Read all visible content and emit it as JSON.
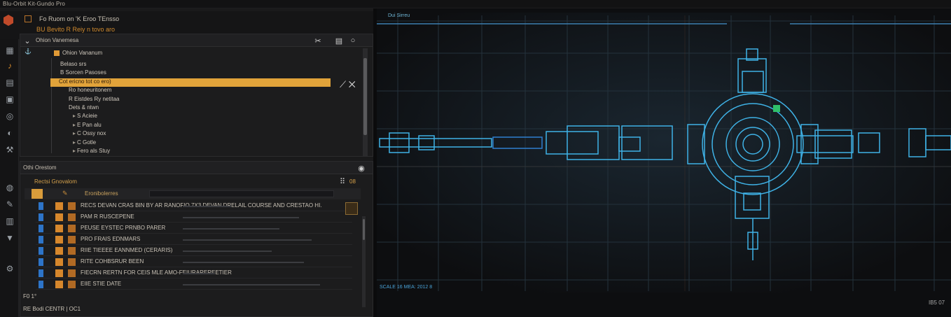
{
  "window": {
    "title": "Blu-Orbit Kit-Gundo Pro"
  },
  "header": {
    "line1": "Fo Ruom on 'K Eroo TEnsso",
    "line2": "BU Bevito R Reiy n tovo aro"
  },
  "outliner": {
    "title": "Ohion Vanemesa",
    "root": "Ohion Vananum",
    "items": [
      {
        "label": "Belaso srs",
        "depth": 0,
        "selected": false
      },
      {
        "label": "B Sorcen Pasoses",
        "depth": 0,
        "selected": false
      },
      {
        "label": "Cot ericno tot co ero)",
        "depth": 0,
        "selected": true
      },
      {
        "label": "Ro honeuritonem",
        "depth": 1,
        "selected": false
      },
      {
        "label": "R  Eistdes  Ry netitaa",
        "depth": 1,
        "selected": false
      },
      {
        "label": "Dets & ntwn",
        "depth": 1,
        "selected": false
      },
      {
        "label": "S Acieie",
        "depth": 2,
        "selected": false
      },
      {
        "label": "E Pan alu",
        "depth": 2,
        "selected": false
      },
      {
        "label": "C Ossy nox",
        "depth": 2,
        "selected": false
      },
      {
        "label": "C Gotle",
        "depth": 2,
        "selected": false
      },
      {
        "label": "Fero  als Stuy",
        "depth": 2,
        "selected": false
      }
    ]
  },
  "props": {
    "title": "Othi Orestom",
    "subtitle": "Rectsi Gnovalom",
    "tab": "Eronibolerres",
    "count": "08",
    "rows": [
      {
        "label": "RECS DEVAN CRAS BIN BY AR RANOFIO 7X3 DEVAN DRELAIL COURSE AND CRESTAO HI.",
        "bar": 0.3
      },
      {
        "label": "PAM R RUSCEPENE",
        "bar": 0.72
      },
      {
        "label": "PEUSE EYSTEC PRNBO PARER",
        "bar": 0.6
      },
      {
        "label": "PRO FRAIS EDNMARS",
        "bar": 0.8
      },
      {
        "label": "RIIE TIEEEE EANNMED (CERARIS)",
        "bar": 0.55
      },
      {
        "label": "RITE COHBSRUR BEEN",
        "bar": 0.75
      },
      {
        "label": "FIECRN RERTN FOR CEIS MLE AMO-FEIURAREREETIER",
        "bar": 0.2
      },
      {
        "label": "EIIE STIE DATE",
        "bar": 0.85
      }
    ],
    "footer": "F0 1°",
    "status": "RE Bodi  CENTR | OC1"
  },
  "viewport": {
    "label": "Dui Sirreu",
    "footer_left": "SCALE 16 MEA: 2012 8",
    "footer_right": "IB5 07"
  },
  "colors": {
    "accent": "#e1a33a",
    "blueprint": "#3fb2e6",
    "background": "#0d0e10"
  }
}
